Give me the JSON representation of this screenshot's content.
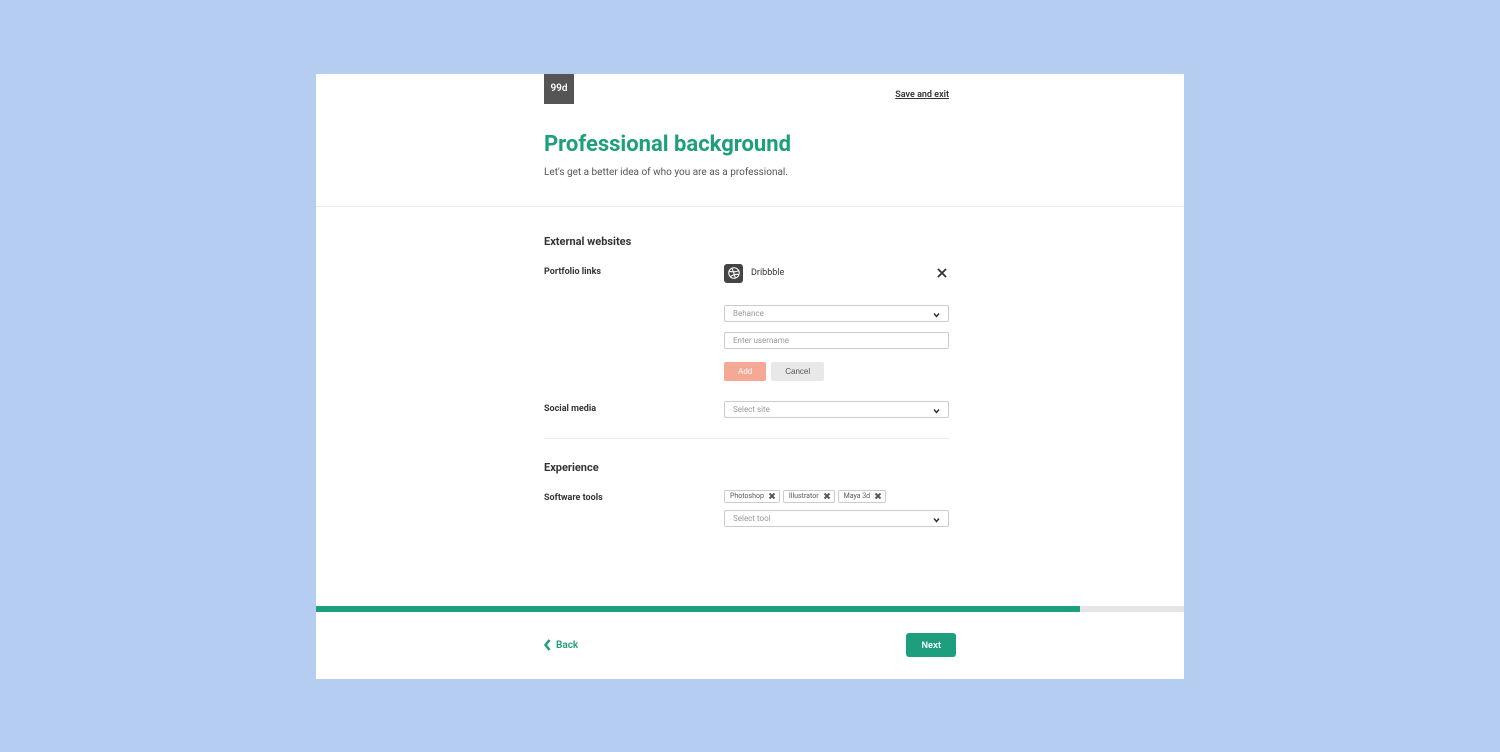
{
  "logo_text": "99d",
  "header": {
    "save_exit": "Save and exit",
    "title": "Professional background",
    "subtitle": "Let's get a better idea of who you are as a professional."
  },
  "sections": {
    "external": {
      "title": "External websites",
      "portfolio": {
        "label": "Portfolio links",
        "linked": {
          "name": "Dribbble"
        },
        "select_value": "Behance",
        "username_placeholder": "Enter username",
        "add_label": "Add",
        "cancel_label": "Cancel"
      },
      "social": {
        "label": "Social media",
        "select_placeholder": "Select site"
      }
    },
    "experience": {
      "title": "Experience",
      "software": {
        "label": "Software tools",
        "tags": [
          "Photoshop",
          "Illustrator",
          "Maya 3d"
        ],
        "select_placeholder": "Select tool"
      }
    }
  },
  "progress_percent": 88,
  "footer": {
    "back": "Back",
    "next": "Next"
  }
}
